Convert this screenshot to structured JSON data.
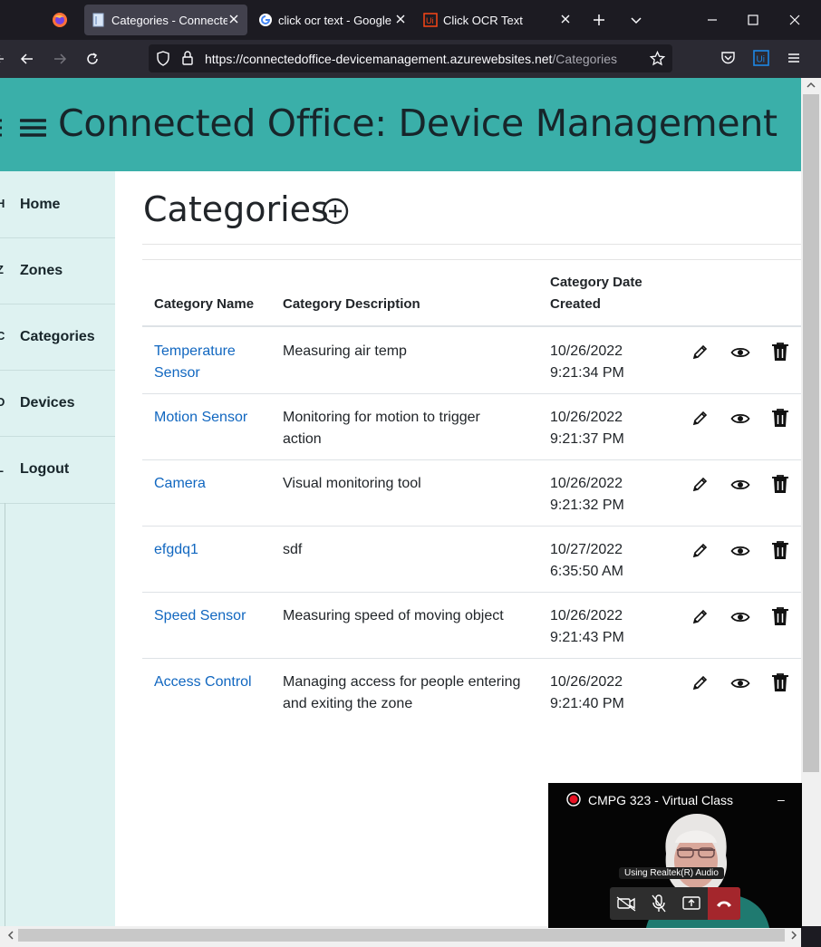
{
  "browser": {
    "tabs": [
      {
        "title": "Categories - Connected",
        "active": true,
        "icon": "page-icon"
      },
      {
        "title": "click ocr text - Google S",
        "active": false,
        "icon": "google-icon"
      },
      {
        "title": "Click OCR Text",
        "active": false,
        "icon": "uipath-icon"
      }
    ],
    "url_host": "https://connectedoffice-devicemanagement.azurewebsites.net",
    "url_path": "/Categories"
  },
  "header": {
    "title": "Connected Office: Device Management"
  },
  "sidebar": {
    "items": [
      {
        "label": "Home",
        "edge": "H"
      },
      {
        "label": "Zones",
        "edge": "Z"
      },
      {
        "label": "Categories",
        "edge": "C"
      },
      {
        "label": "Devices",
        "edge": "D"
      },
      {
        "label": "Logout",
        "edge": "L"
      }
    ]
  },
  "main": {
    "title": "Categories",
    "columns": [
      "Category Name",
      "Category Description",
      "Category Date Created"
    ],
    "rows": [
      {
        "name": [
          "Temperature",
          "Sensor"
        ],
        "description": [
          "Measuring air temp"
        ],
        "date": "10/26/2022",
        "time": "9:21:34 PM"
      },
      {
        "name": [
          "Motion Sensor"
        ],
        "description": [
          "Monitoring for motion to trigger",
          "action"
        ],
        "date": "10/26/2022",
        "time": "9:21:37 PM"
      },
      {
        "name": [
          "Camera"
        ],
        "description": [
          "Visual monitoring tool"
        ],
        "date": "10/26/2022",
        "time": "9:21:32 PM"
      },
      {
        "name": [
          "efgdq1"
        ],
        "description": [
          "sdf"
        ],
        "date": "10/27/2022",
        "time": "6:35:50 AM"
      },
      {
        "name": [
          "Speed Sensor"
        ],
        "description": [
          "Measuring speed of moving object"
        ],
        "date": "10/26/2022",
        "time": "9:21:43 PM"
      },
      {
        "name": [
          "Access Control"
        ],
        "description": [
          "Managing access for people entering",
          "and exiting the zone"
        ],
        "date": "10/26/2022",
        "time": "9:21:40 PM"
      }
    ]
  },
  "meeting": {
    "title": "CMPG 323 - Virtual Class",
    "audio_label": "Using Realtek(R) Audio",
    "minimize": "–"
  },
  "colors": {
    "header_bg": "#3aafa9",
    "sidebar_bg": "#def2f1",
    "link": "#1167c0",
    "text": "#17252a"
  }
}
